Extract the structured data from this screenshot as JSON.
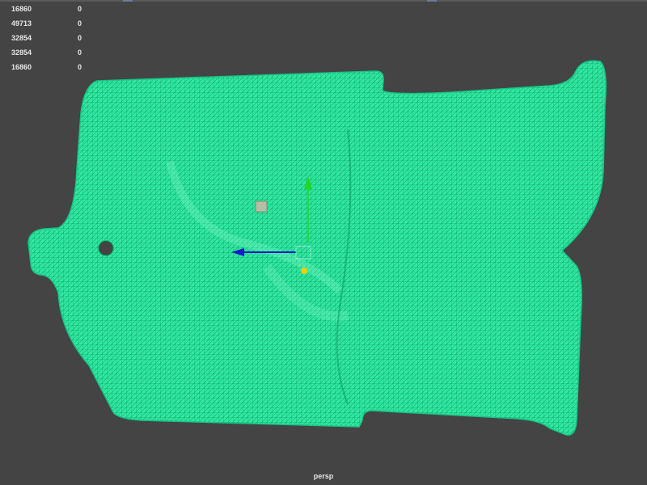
{
  "hud": {
    "rows": [
      {
        "value": "16860",
        "selected": "0"
      },
      {
        "value": "49713",
        "selected": "0"
      },
      {
        "value": "32854",
        "selected": "0"
      },
      {
        "value": "32854",
        "selected": "0"
      },
      {
        "value": "16860",
        "selected": "0"
      }
    ]
  },
  "viewport": {
    "camera_label": "persp",
    "background_color": "#444444",
    "mesh_color": "#2fe8a0"
  },
  "manipulator": {
    "y_axis_color": "#22d822",
    "x_axis_color": "#1a1acc",
    "pivot_color": "#f0d000"
  }
}
